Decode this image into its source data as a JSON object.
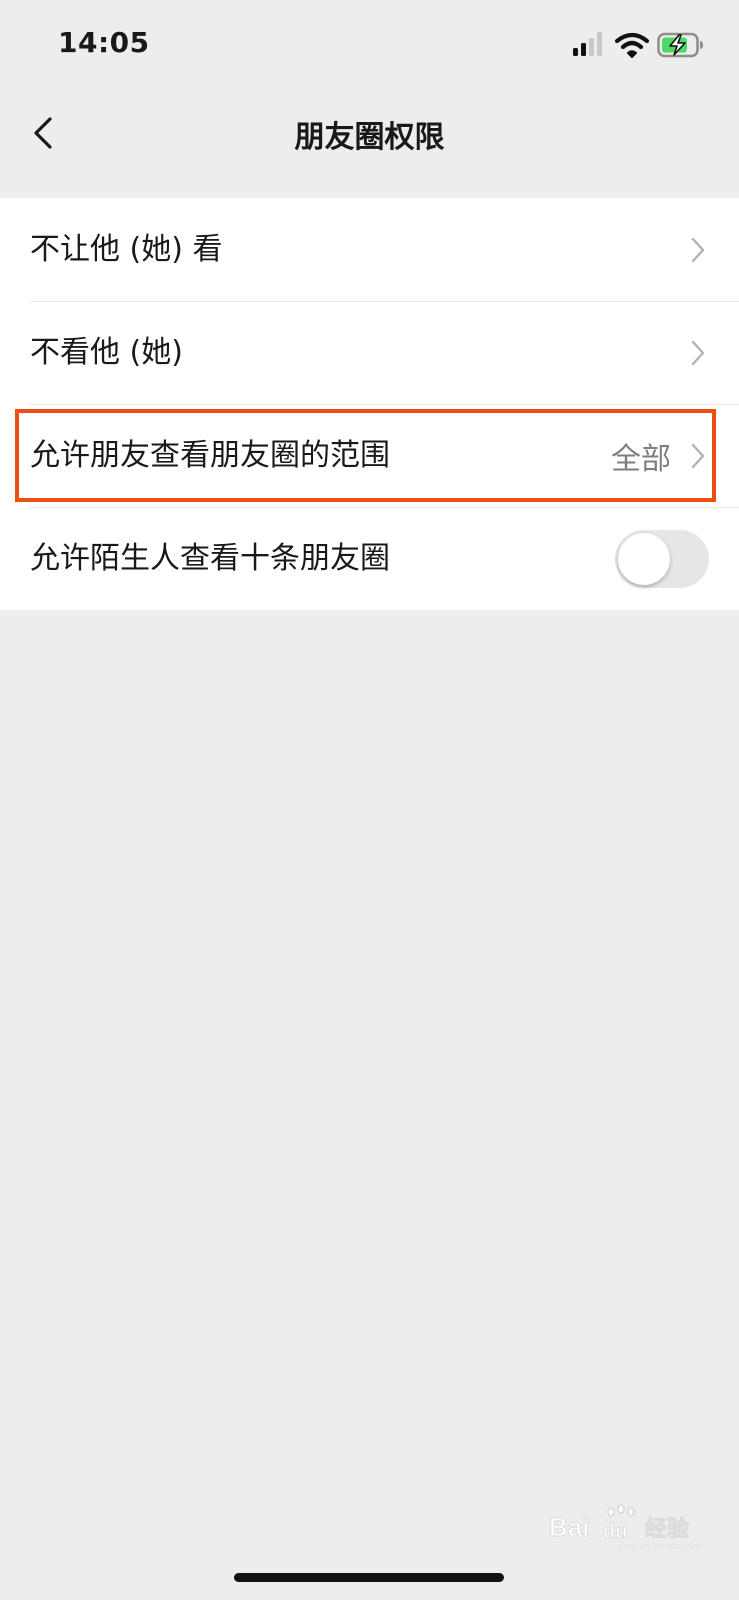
{
  "status_bar": {
    "time": "14:05",
    "icons": [
      "cellular-signal-icon",
      "wifi-icon",
      "battery-charging-icon"
    ]
  },
  "nav": {
    "title": "朋友圈权限",
    "back_icon": "chevron-left-icon"
  },
  "settings": {
    "items": [
      {
        "label": "不让他 (她) 看",
        "type": "link"
      },
      {
        "label": "不看他 (她)",
        "type": "link"
      },
      {
        "label": "允许朋友查看朋友圈的范围",
        "value": "全部",
        "type": "link",
        "highlighted": true
      },
      {
        "label": "允许陌生人查看十条朋友圈",
        "type": "toggle",
        "toggle_on": false
      }
    ]
  },
  "watermark": {
    "brand": "Bai du 经验",
    "url": "jingyan.baidu.com"
  },
  "colors": {
    "background": "#ededed",
    "card": "#ffffff",
    "highlight_border": "#ef4d13",
    "secondary_text": "#7f7f7f",
    "battery_green": "#4cd964"
  }
}
